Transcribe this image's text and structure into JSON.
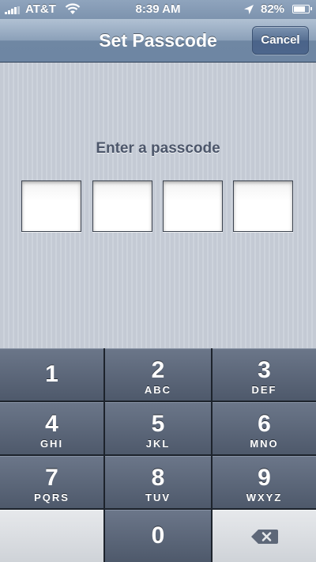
{
  "status_bar": {
    "carrier": "AT&T",
    "time": "8:39 AM",
    "battery_percent": "82%",
    "battery_level": 0.82,
    "icons": [
      "signal-icon",
      "wifi-icon",
      "location-arrow-icon",
      "battery-icon"
    ]
  },
  "nav_bar": {
    "title": "Set Passcode",
    "cancel_label": "Cancel"
  },
  "passcode": {
    "prompt": "Enter a passcode",
    "entered_digits": 0,
    "total_digits": 4
  },
  "keypad": {
    "keys": [
      {
        "num": "1",
        "letters": ""
      },
      {
        "num": "2",
        "letters": "ABC"
      },
      {
        "num": "3",
        "letters": "DEF"
      },
      {
        "num": "4",
        "letters": "GHI"
      },
      {
        "num": "5",
        "letters": "JKL"
      },
      {
        "num": "6",
        "letters": "MNO"
      },
      {
        "num": "7",
        "letters": "PQRS"
      },
      {
        "num": "8",
        "letters": "TUV"
      },
      {
        "num": "9",
        "letters": "WXYZ"
      },
      {
        "num": "0",
        "letters": ""
      }
    ],
    "delete_icon": "delete-backspace-icon"
  },
  "colors": {
    "nav_bar": "#7d93ae",
    "key_dark": "#5a6578",
    "key_light": "#dcdfe3",
    "prompt_text": "#4c566a"
  }
}
